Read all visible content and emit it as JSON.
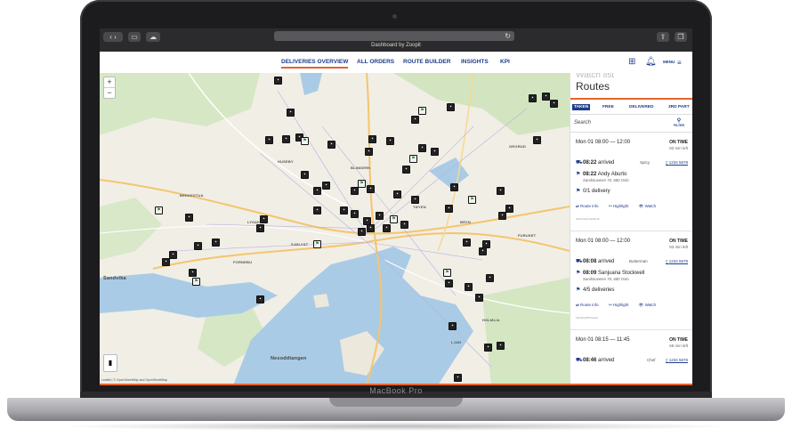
{
  "laptop": {
    "model_label": "MacBook Pro"
  },
  "browser": {
    "tab_title": "Dashboard by Zoopit"
  },
  "nav": {
    "items": [
      {
        "label": "DELIVERIES OVERVIEW",
        "active": true
      },
      {
        "label": "ALL ORDERS",
        "active": false
      },
      {
        "label": "ROUTE BUILDER",
        "active": false
      },
      {
        "label": "INSIGHTS",
        "active": false
      },
      {
        "label": "KPI",
        "active": false
      }
    ],
    "menu_label": "MENU",
    "icons": [
      "add-document-icon",
      "bell-icon",
      "menu-icon"
    ]
  },
  "map": {
    "zoom_in": "+",
    "zoom_out": "−",
    "attribution": "Leaflet | © OpenStreetMap and OpenStreetMap",
    "places": {
      "sandvika": "Sandvika",
      "nesodden": "Nesoddtangen",
      "huseby": "HUSEBY",
      "blindern": "BLINDERN",
      "tøyen": "TØYEN",
      "lysaker": "LYSAKER",
      "bekkestua": "BEKKESTUA",
      "fornebu": "FORNEBU",
      "grorud": "GRORUD",
      "furuset": "FURUSET",
      "bryn": "BRYN",
      "holmlia": "HOLMLIA",
      "ljan": "LJAN",
      "sjolyst": "SJØLYST"
    }
  },
  "sidebar": {
    "watch_list_title": "Watch list",
    "title": "Routes",
    "filters": [
      {
        "label": "TAKEN",
        "active": true
      },
      {
        "label": "FREE",
        "active": false
      },
      {
        "label": "DELIVERED",
        "active": false
      },
      {
        "label": "3RD PART",
        "active": false
      }
    ],
    "search_label": "Search",
    "filter_label": "FILTER",
    "routes": [
      {
        "date": "Mon 01 08:00 — 12:00",
        "status": "ON TIME",
        "time_left": "83 min left",
        "arrived_time": "08:22",
        "arrived_label": "arrived",
        "driver": "Spicy",
        "phone": "1234 5678",
        "stop_time": "08:22",
        "stop_name": "Andy Aburto",
        "stop_address": "Sandstuveien 70, 680 Oslo",
        "deliveries": "0/1 delivery",
        "actions": [
          "Route info",
          "Highlight",
          "Watch"
        ],
        "route_id": "18a47de2c41b2b4b"
      },
      {
        "date": "Mon 01 08:00 — 12:00",
        "status": "ON TIME",
        "time_left": "83 min left",
        "arrived_time": "08:08",
        "arrived_label": "arrived",
        "driver": "Butterman",
        "phone": "1234 5678",
        "stop_time": "08:09",
        "stop_name": "Sanjuana Stockwell",
        "stop_address": "Sandstuveien 70, 680 Oslo",
        "deliveries": "4/5 deliveries",
        "actions": [
          "Route info",
          "Highlight",
          "Watch"
        ],
        "route_id": "1f0c2be28f47a1e9"
      },
      {
        "date": "Mon 01 08:15 — 11:45",
        "status": "ON TIME",
        "time_left": "68 min left",
        "arrived_time": "08:46",
        "arrived_label": "arrived",
        "driver": "Chef",
        "phone": "1234 5678"
      }
    ]
  },
  "colors": {
    "brand_blue": "#1f3d8a",
    "accent_orange": "#e8632b",
    "water": "#aacbe5",
    "park": "#cfe3bd"
  }
}
